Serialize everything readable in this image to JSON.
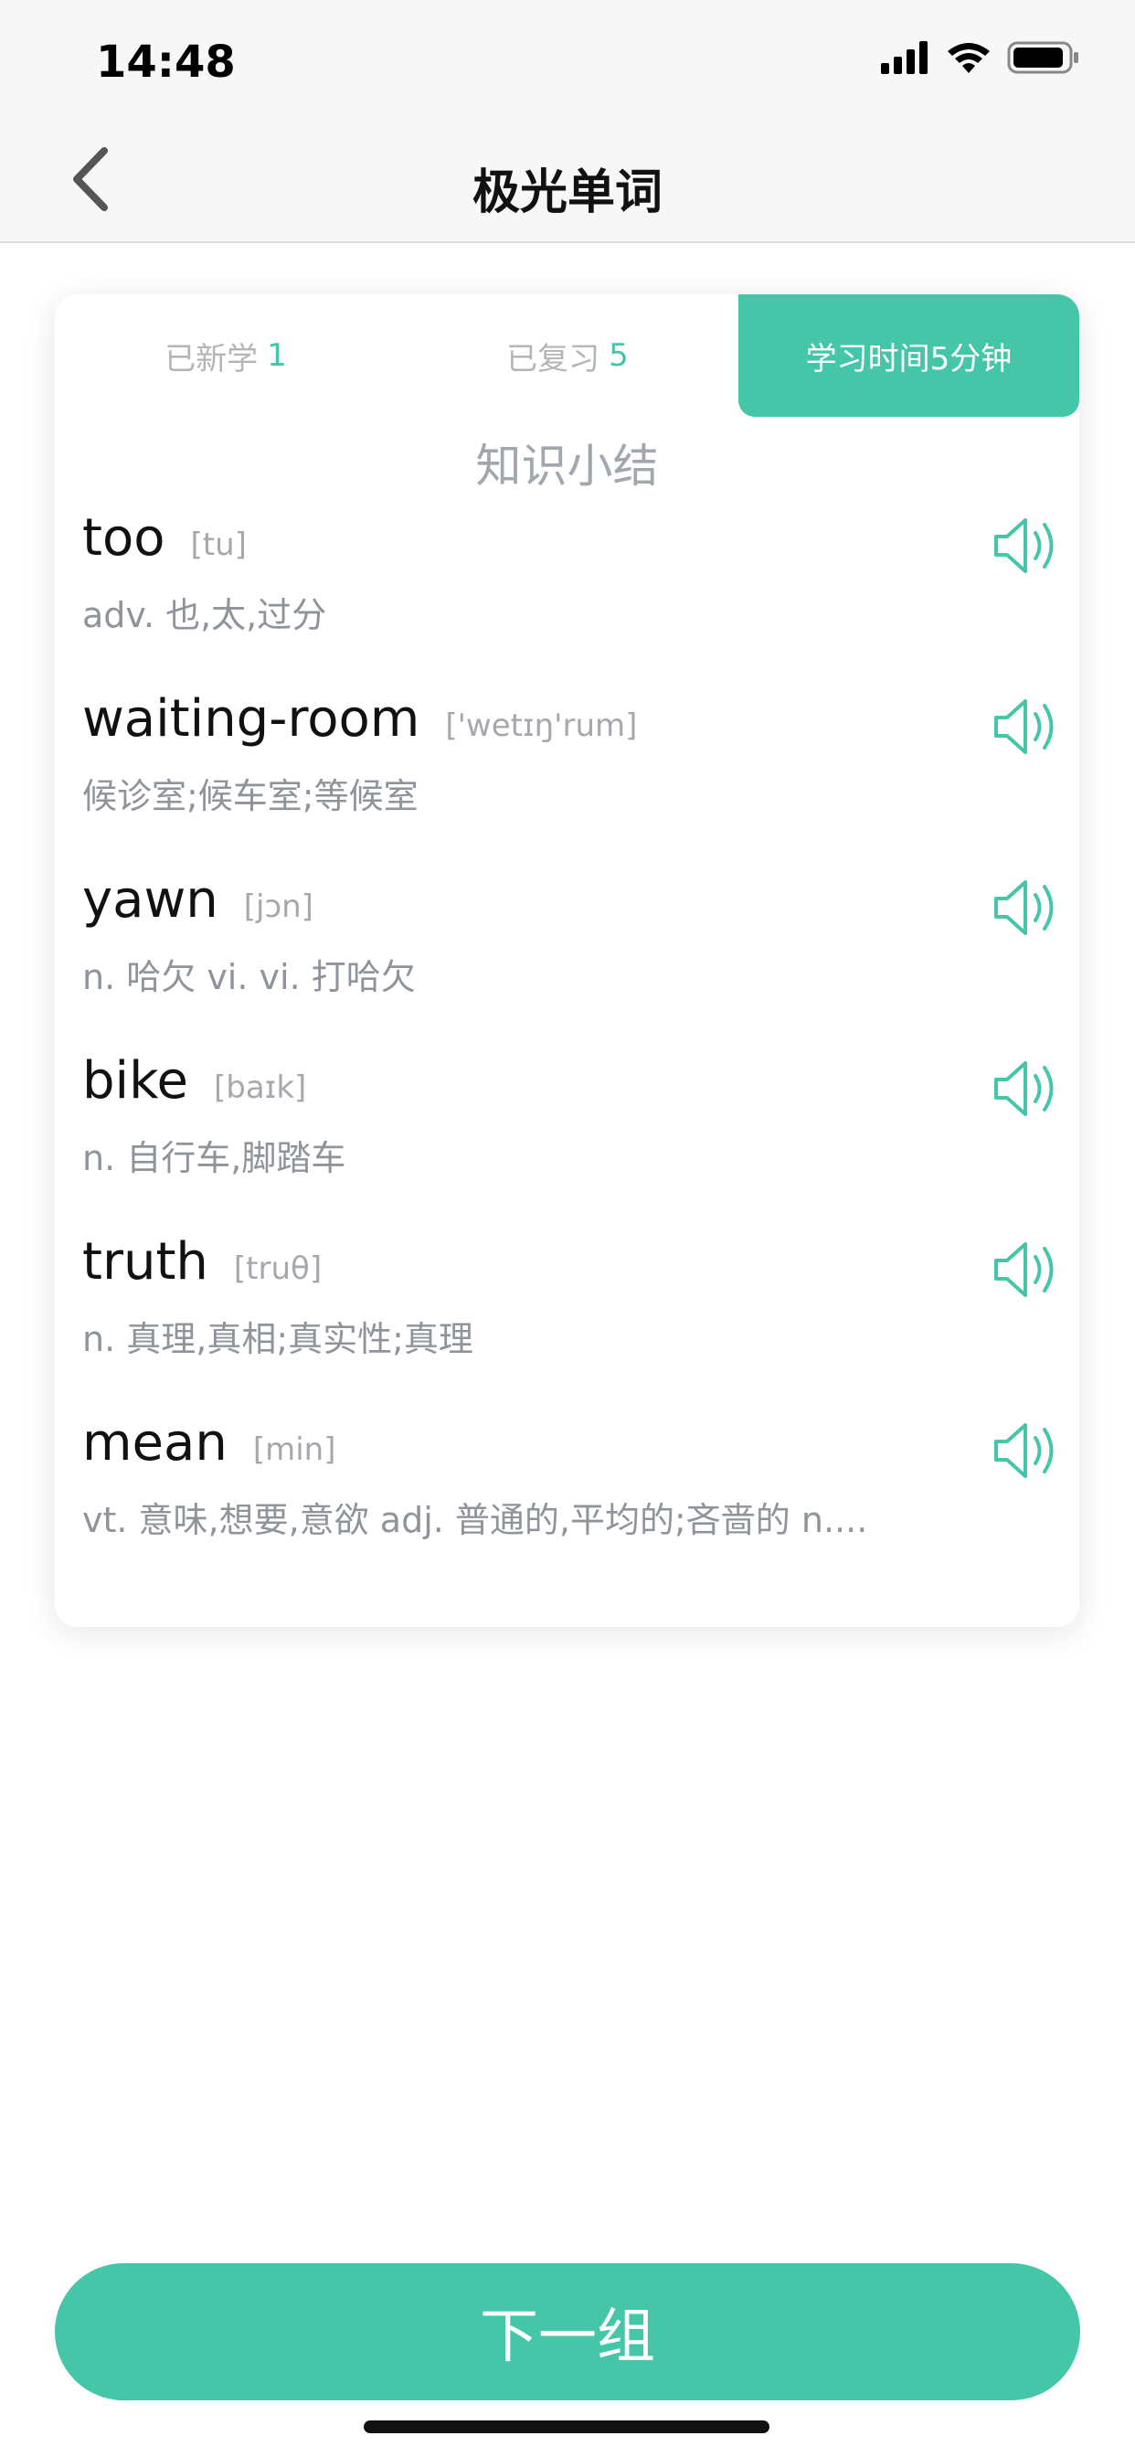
{
  "status_bar": {
    "time": "14:48"
  },
  "nav": {
    "title": "极光单词"
  },
  "tabs": {
    "new_label": "已新学",
    "new_count": "1",
    "review_label": "已复习",
    "review_count": "5",
    "time_label": "学习时间5分钟"
  },
  "summary_title": "知识小结",
  "words": [
    {
      "word": "too",
      "phonetic": "[tu]",
      "meaning": "adv. 也,太,过分"
    },
    {
      "word": "waiting-room",
      "phonetic": "['wetɪŋ'rum]",
      "meaning": "候诊室;候车室;等候室"
    },
    {
      "word": "yawn",
      "phonetic": "[jɔn]",
      "meaning": "n. 哈欠 vi. vi. 打哈欠"
    },
    {
      "word": "bike",
      "phonetic": "[baɪk]",
      "meaning": "n. 自行车,脚踏车"
    },
    {
      "word": "truth",
      "phonetic": "[truθ]",
      "meaning": "n. 真理,真相;真实性;真理"
    },
    {
      "word": "mean",
      "phonetic": "[min]",
      "meaning": "vt. 意味,想要,意欲 adj. 普通的,平均的;吝啬的 n...."
    }
  ],
  "next_button": "下一组",
  "colors": {
    "accent": "#45c6a9",
    "text_primary": "#111111",
    "text_secondary": "#8f949b"
  },
  "icons": {
    "back": "chevron-left-icon",
    "speaker": "speaker-icon",
    "signal": "cellular-signal-icon",
    "wifi": "wifi-icon",
    "battery": "battery-icon"
  }
}
